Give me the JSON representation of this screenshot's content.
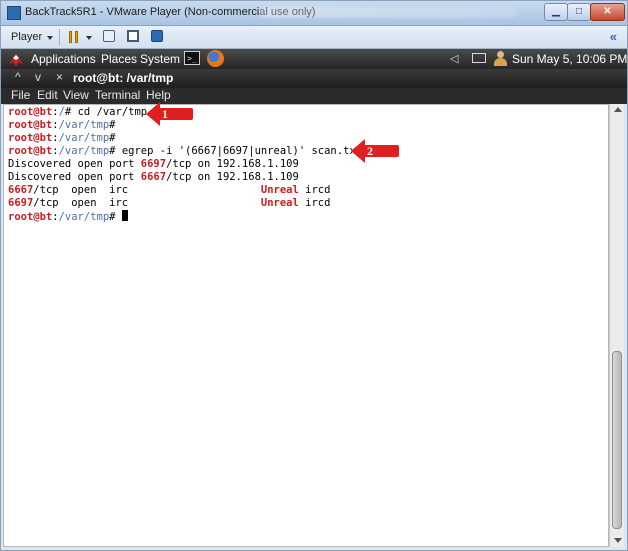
{
  "vmware": {
    "title": "BackTrack5R1 - VMware Player (Non-commercial use only)",
    "player_menu": "Player",
    "collapse_glyph": "«",
    "min_glyph": "▁",
    "max_glyph": "□",
    "close_glyph": "✕"
  },
  "panel": {
    "applications": "Applications",
    "places": "Places",
    "system": "System",
    "terminal_glyph": ">_",
    "clock": "Sun May  5, 10:06 PM",
    "volume_glyph": "◁"
  },
  "window": {
    "title": "root@bt: /var/tmp",
    "up_glyph": "^",
    "down_glyph": "v",
    "close_glyph": "×"
  },
  "menubar": {
    "file": "File",
    "edit": "Edit",
    "view": "View",
    "terminal": "Terminal",
    "help": "Help"
  },
  "terminal": {
    "prompt_user": "root@bt",
    "l1_dir": "/",
    "l1_cmd": "# cd /var/tmp",
    "dir_tmp": "/var/tmp",
    "hash": "#",
    "l4_cmd": "# egrep -i '(6667|6697|unreal)' scan.txt",
    "disc_prefix": "Discovered open port ",
    "port_6697": "6697",
    "port_6667": "6667",
    "disc_suffix": "/tcp on 192.168.1.109",
    "svc_mid": "/tcp  open  irc                     ",
    "unreal": "Unreal",
    "ircd": " ircd"
  },
  "callouts": {
    "one": "1",
    "two": "2"
  },
  "colors": {
    "prompt": "#c82020",
    "path": "#4a6fb0",
    "callout": "#e02020"
  }
}
